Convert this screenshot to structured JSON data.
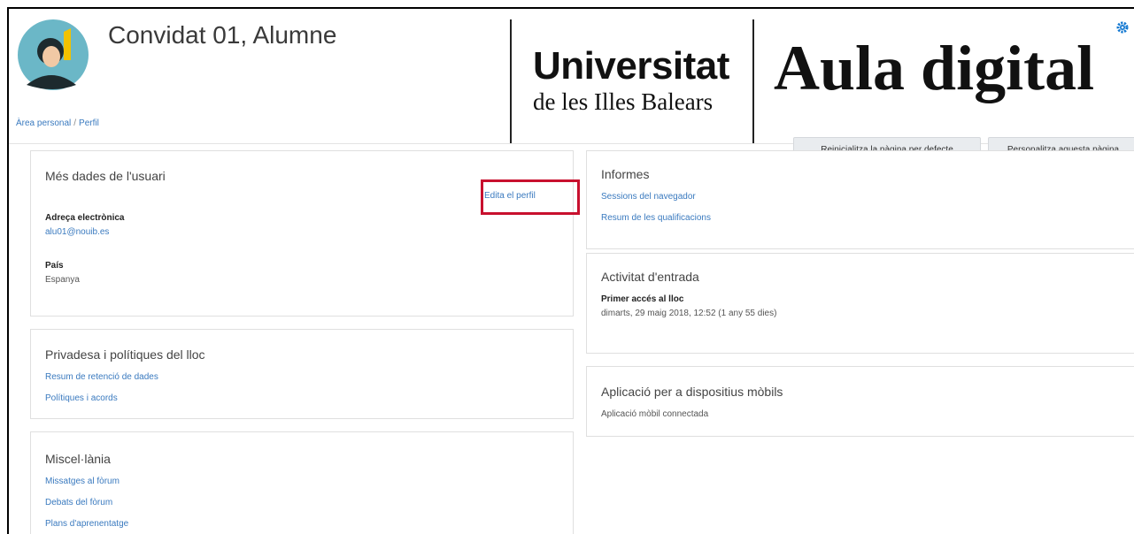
{
  "user": {
    "name": "Convidat 01, Alumne"
  },
  "breadcrumb": {
    "items": [
      "Àrea personal",
      "Perfil"
    ],
    "separator": "/"
  },
  "branding": {
    "uni_title": "Universitat",
    "uni_subtitle": "de les Illes Balears",
    "site_name": "Aula digital"
  },
  "header_buttons": {
    "reset": "Reinicialitza la pàgina per defecte",
    "customize": "Personalitza aquesta pàgina"
  },
  "card_user": {
    "title": "Més dades de l'usuari",
    "edit_link": "Edita el perfil",
    "email_label": "Adreça electrònica",
    "email_value": "alu01@nouib.es",
    "country_label": "País",
    "country_value": "Espanya"
  },
  "card_privacy": {
    "title": "Privadesa i polítiques del lloc",
    "links": [
      "Resum de retenció de dades",
      "Polítiques i acords"
    ]
  },
  "card_misc": {
    "title": "Miscel·lània",
    "links": [
      "Missatges al fòrum",
      "Debats del fòrum",
      "Plans d'aprenentatge"
    ]
  },
  "card_reports": {
    "title": "Informes",
    "links": [
      "Sessions del navegador",
      "Resum de les qualificacions"
    ]
  },
  "card_login": {
    "title": "Activitat d'entrada",
    "first_access_label": "Primer accés al lloc",
    "first_access_value": "dimarts, 29 maig 2018, 12:52  (1 any 55 dies)"
  },
  "card_mobile": {
    "title": "Aplicació per a dispositius mòbils",
    "status": "Aplicació mòbil connectada"
  },
  "colors": {
    "link": "#3a7abf",
    "highlight": "#c8102e",
    "gear": "#1177d1"
  },
  "icons": [
    "avatar",
    "gear-icon"
  ]
}
